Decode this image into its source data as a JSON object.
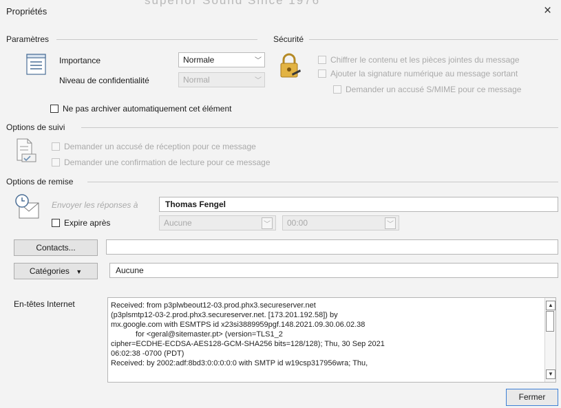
{
  "background_text": "superior Sound Since 1976",
  "window": {
    "title": "Propriétés",
    "close": "×"
  },
  "parametres": {
    "label": "Paramètres",
    "importance_label": "Importance",
    "importance_value": "Normale",
    "confid_label": "Niveau de confidentialité",
    "confid_value": "Normal",
    "no_archive": "Ne pas archiver automatiquement cet élément"
  },
  "securite": {
    "label": "Sécurité",
    "encrypt": "Chiffrer le contenu et les pièces jointes du message",
    "sign": "Ajouter la signature numérique au message sortant",
    "smime": "Demander un accusé S/MIME pour ce message"
  },
  "suivi": {
    "label": "Options de suivi",
    "receipt": "Demander un accusé de réception pour ce message",
    "read": "Demander une confirmation de lecture pour ce message"
  },
  "remise": {
    "label": "Options de remise",
    "reply_to_label": "Envoyer les réponses à",
    "reply_to_value": "Thomas Fengel",
    "expires_label": "Expire après",
    "expires_date": "Aucune",
    "expires_time": "00:00"
  },
  "contacts": {
    "button": "Contacts...",
    "value": ""
  },
  "categories": {
    "button": "Catégories",
    "value": "Aucune"
  },
  "headers": {
    "label": "En-têtes Internet",
    "lines": [
      "Received: from p3plwbeout12-03.prod.phx3.secureserver.net",
      "(p3plsmtp12-03-2.prod.phx3.secureserver.net. [173.201.192.58])          by",
      "mx.google.com with ESMTPS id x23si3889959pgf.148.2021.09.30.06.02.38",
      "for <geral@sitemaster.pt>       (version=TLS1_2",
      "cipher=ECDHE-ECDSA-AES128-GCM-SHA256 bits=128/128);         Thu, 30 Sep 2021",
      "06:02:38 -0700 (PDT)",
      "Received: by 2002:adf:8bd3:0:0:0:0:0 with SMTP id w19csp317956wra;          Thu,"
    ]
  },
  "footer": {
    "close_button": "Fermer"
  }
}
